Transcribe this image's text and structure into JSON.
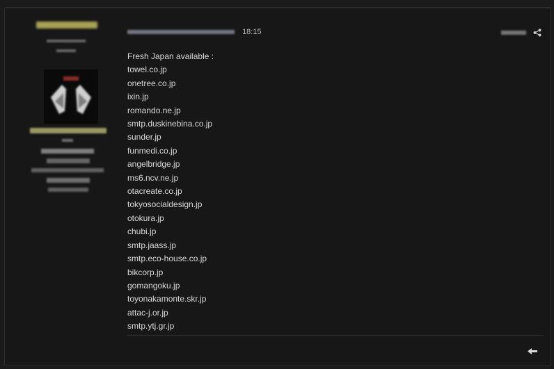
{
  "post": {
    "time": "18:15",
    "lines": [
      "Fresh Japan available  :",
      "towel.co.jp",
      "onetree.co.jp",
      "ixin.jp",
      "romando.ne.jp",
      "smtp.duskinebina.co.jp",
      "sunder.jp",
      "funmedi.co.jp",
      "angelbridge.jp",
      "ms6.ncv.ne.jp",
      "otacreate.co.jp",
      "tokyosocialdesign.jp",
      "otokura.jp",
      "chubi.jp",
      "smtp.jaass.jp",
      "smtp.eco-house.co.jp",
      "bikcorp.jp",
      "gomangoku.jp",
      "toyonakamonte.skr.jp",
      "attac-j.or.jp",
      "smtp.ytj.gr.jp"
    ]
  },
  "icons": {
    "share": "share-icon",
    "reply": "reply-icon",
    "avatar": "avatar"
  },
  "colors": {
    "background": "#171717",
    "text": "#d9d9d9",
    "username": "#e4e07b",
    "user_meta": "#c9c88a"
  }
}
